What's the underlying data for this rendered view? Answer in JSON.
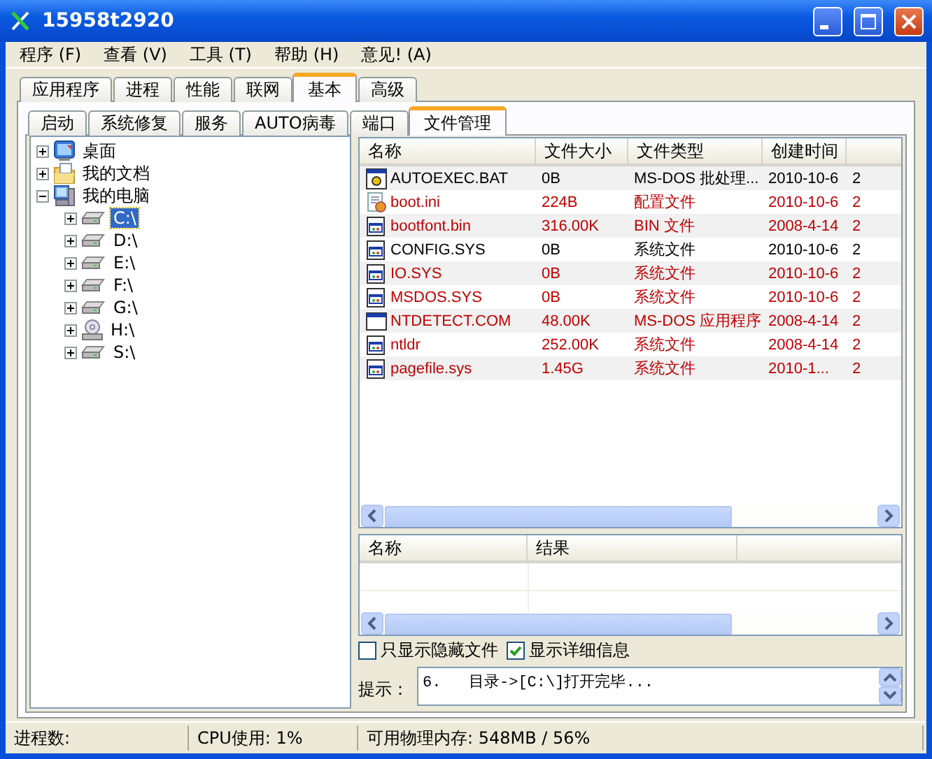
{
  "window": {
    "title": "15958t2920"
  },
  "menu": [
    "程序 (F)",
    "查看 (V)",
    "工具 (T)",
    "帮助 (H)",
    "意见! (A)"
  ],
  "tabs": [
    {
      "label": "应用程序",
      "selected": false
    },
    {
      "label": "进程",
      "selected": false
    },
    {
      "label": "性能",
      "selected": false
    },
    {
      "label": "联网",
      "selected": false
    },
    {
      "label": "基本",
      "selected": true
    },
    {
      "label": "高级",
      "selected": false
    }
  ],
  "subtabs": [
    {
      "label": "启动",
      "selected": false
    },
    {
      "label": "系统修复",
      "selected": false
    },
    {
      "label": "服务",
      "selected": false
    },
    {
      "label": "AUTO病毒",
      "selected": false
    },
    {
      "label": "端口",
      "selected": false
    },
    {
      "label": "文件管理",
      "selected": true
    }
  ],
  "tree": [
    {
      "label": "桌面",
      "kind": "desktop",
      "expanded": false,
      "selected": false
    },
    {
      "label": "我的文档",
      "kind": "documents",
      "expanded": false,
      "selected": false
    },
    {
      "label": "我的电脑",
      "kind": "computer",
      "expanded": true,
      "selected": false,
      "children": [
        {
          "label": "C:\\",
          "kind": "drive",
          "expanded": false,
          "selected": true
        },
        {
          "label": "D:\\",
          "kind": "drive",
          "expanded": false,
          "selected": false
        },
        {
          "label": "E:\\",
          "kind": "drive",
          "expanded": false,
          "selected": false
        },
        {
          "label": "F:\\",
          "kind": "drive",
          "expanded": false,
          "selected": false
        },
        {
          "label": "G:\\",
          "kind": "drive",
          "expanded": false,
          "selected": false
        },
        {
          "label": "H:\\",
          "kind": "cdrom",
          "expanded": false,
          "selected": false
        },
        {
          "label": "S:\\",
          "kind": "drive",
          "expanded": false,
          "selected": false
        }
      ]
    }
  ],
  "files": {
    "columns": [
      "名称",
      "文件大小",
      "文件类型",
      "创建时间"
    ],
    "rows": [
      {
        "kind": "batch",
        "hidden": false,
        "cells": [
          "AUTOEXEC.BAT",
          "0B",
          "MS-DOS 批处理...",
          "2010-10-6",
          "2"
        ]
      },
      {
        "kind": "settings",
        "hidden": true,
        "cells": [
          "boot.ini",
          "224B",
          "配置文件",
          "2010-10-6",
          "2"
        ]
      },
      {
        "kind": "system",
        "hidden": true,
        "cells": [
          "bootfont.bin",
          "316.00K",
          "BIN 文件",
          "2008-4-14",
          "2"
        ]
      },
      {
        "kind": "system",
        "hidden": false,
        "cells": [
          "CONFIG.SYS",
          "0B",
          "系统文件",
          "2010-10-6",
          "2"
        ]
      },
      {
        "kind": "system",
        "hidden": true,
        "cells": [
          "IO.SYS",
          "0B",
          "系统文件",
          "2010-10-6",
          "2"
        ]
      },
      {
        "kind": "system",
        "hidden": true,
        "cells": [
          "MSDOS.SYS",
          "0B",
          "系统文件",
          "2010-10-6",
          "2"
        ]
      },
      {
        "kind": "program",
        "hidden": true,
        "cells": [
          "NTDETECT.COM",
          "48.00K",
          "MS-DOS 应用程序",
          "2008-4-14",
          "2"
        ]
      },
      {
        "kind": "system",
        "hidden": true,
        "cells": [
          "ntldr",
          "252.00K",
          "系统文件",
          "2008-4-14",
          "2"
        ]
      },
      {
        "kind": "system",
        "hidden": true,
        "cells": [
          "pagefile.sys",
          "1.45G",
          "系统文件",
          "2010-1...",
          "2"
        ]
      }
    ]
  },
  "results": {
    "columns": [
      "名称",
      "结果"
    ]
  },
  "options": [
    {
      "label": "只显示隐藏文件",
      "checked": false
    },
    {
      "label": "显示详细信息",
      "checked": true
    }
  ],
  "hint": {
    "label": "提示：",
    "value": "6.   目录->[C:\\]打开完毕..."
  },
  "status_bar": [
    "进程数:",
    "CPU使用: 1%",
    "可用物理内存: 548MB / 56%"
  ]
}
